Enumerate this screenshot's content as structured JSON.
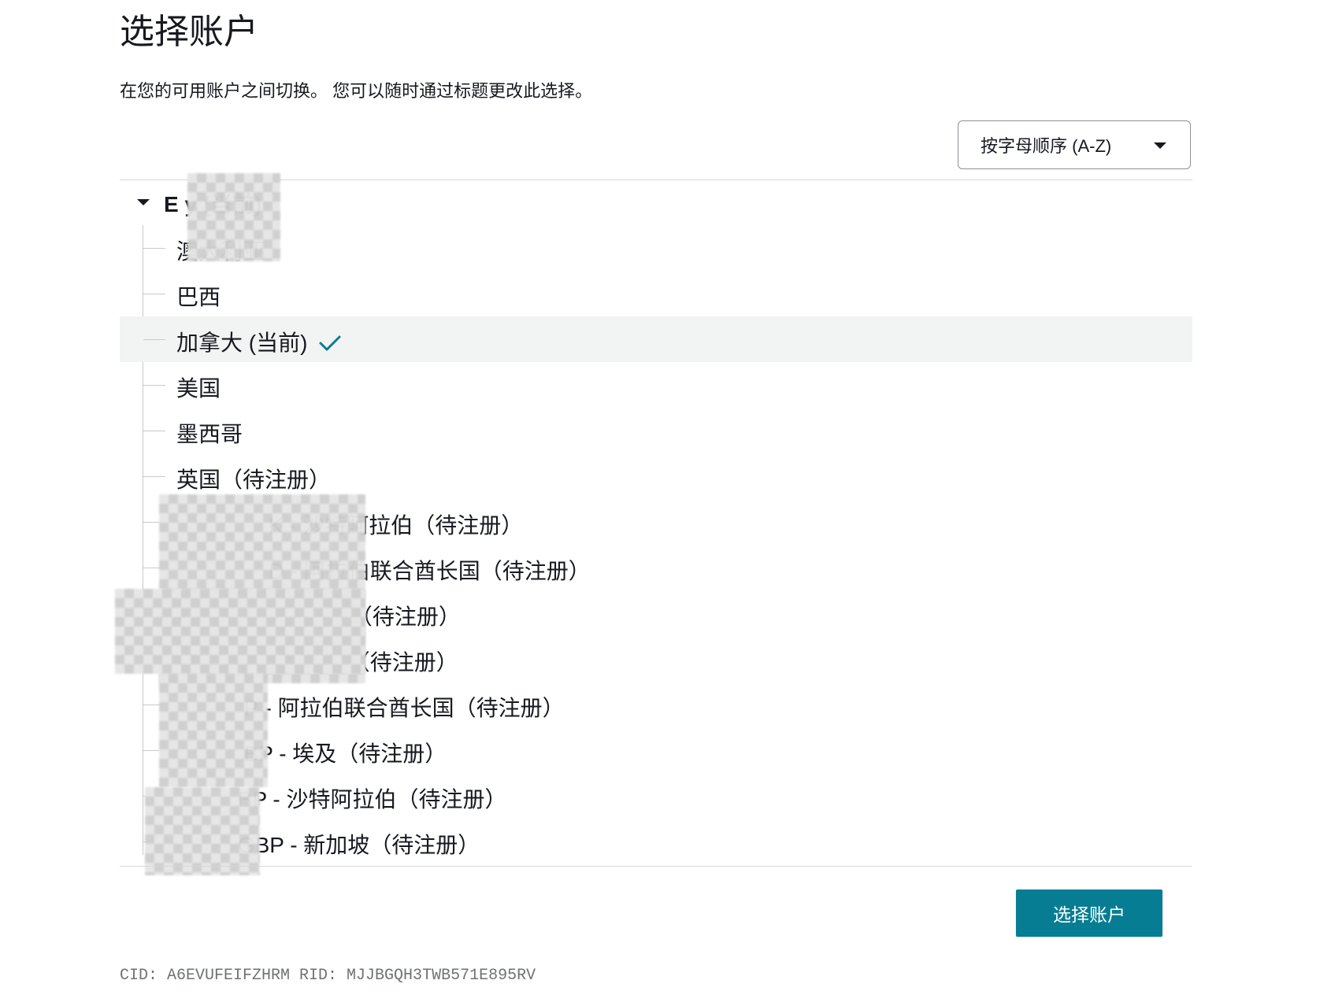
{
  "page": {
    "title": "选择账户",
    "subtitle": "在您的可用账户之间切换。 您可以随时通过标题更改此选择。"
  },
  "sort": {
    "selected": "按字母顺序 (A-Z)"
  },
  "group": {
    "label": "E          y (当前)"
  },
  "items": [
    {
      "label": "澳大利亚"
    },
    {
      "label": "巴西"
    },
    {
      "label": "加拿大 (当前)",
      "current": true
    },
    {
      "label": "美国"
    },
    {
      "label": "墨西哥"
    },
    {
      "label": "英国（待注册）"
    },
    {
      "label": "               K - 沙特阿拉伯（待注册）"
    },
    {
      "label": "               D - 阿拉伯联合酋长国（待注册）"
    },
    {
      "label": "             XN - 埃及（待注册）"
    },
    {
      "label": "               - 新加坡（待注册）"
    },
    {
      "label": "           P - 阿拉伯联合酋长国（待注册）"
    },
    {
      "label": "           BP - 埃及（待注册）"
    },
    {
      "label": "          BP - 沙特阿拉伯（待注册）"
    },
    {
      "label": "          GBP - 新加坡（待注册）"
    }
  ],
  "actions": {
    "submit_label": "选择账户"
  },
  "footer": {
    "ids": "CID: A6EVUFEIFZHRM RID: MJJBGQH3TWB571E895RV"
  },
  "colors": {
    "primary_button": "#067d92",
    "check": "#067d92",
    "selected_row": "#f2f3f3"
  },
  "icons": {
    "sort_dropdown": "caret-down-icon",
    "group_toggle": "caret-down-icon",
    "current_marker": "checkmark-icon"
  }
}
